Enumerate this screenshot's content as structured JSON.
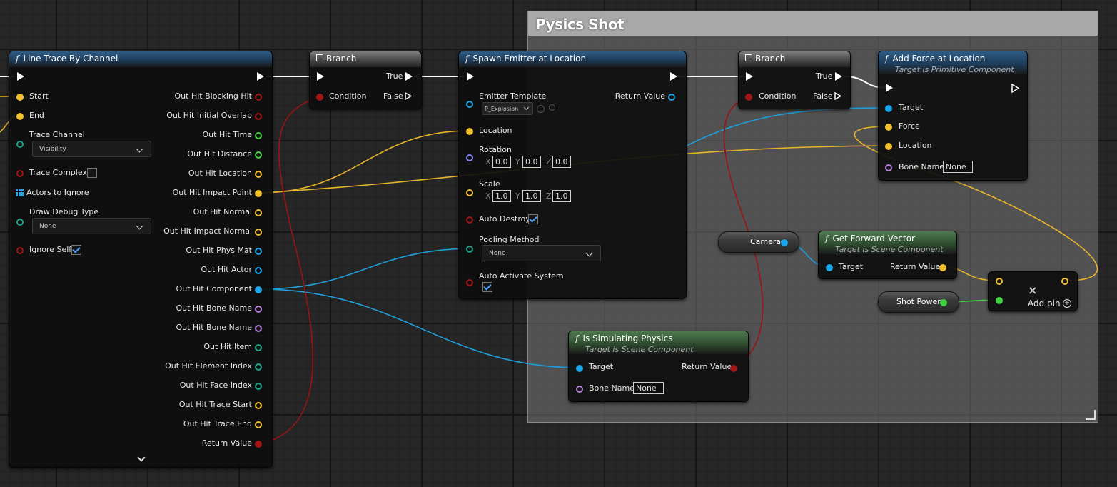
{
  "comment": {
    "title": "Pysics Shot"
  },
  "line_trace": {
    "title": "Line Trace By Channel",
    "inputs": [
      "Start",
      "End",
      "Trace Channel",
      "Trace Complex",
      "Actors to Ignore",
      "Draw Debug Type",
      "Ignore Self"
    ],
    "trace_channel_value": "Visibility",
    "draw_debug_value": "None",
    "outputs": [
      "Out Hit Blocking Hit",
      "Out Hit Initial Overlap",
      "Out Hit Time",
      "Out Hit Distance",
      "Out Hit Location",
      "Out Hit Impact Point",
      "Out Hit Normal",
      "Out Hit Impact Normal",
      "Out Hit Phys Mat",
      "Out Hit Actor",
      "Out Hit Component",
      "Out Hit Bone Name",
      "Out Hit Bone Name",
      "Out Hit Item",
      "Out Hit Element Index",
      "Out Hit Face Index",
      "Out Hit Trace Start",
      "Out Hit Trace End",
      "Return Value"
    ]
  },
  "branch1": {
    "title": "Branch",
    "condition": "Condition",
    "true": "True",
    "false": "False"
  },
  "branch2": {
    "title": "Branch",
    "condition": "Condition",
    "true": "True",
    "false": "False"
  },
  "spawn": {
    "title": "Spawn Emitter at Location",
    "emitter_template": "Emitter Template",
    "emitter_value": "P_Explosion",
    "return_value": "Return Value",
    "location": "Location",
    "rotation": "Rotation",
    "rot": {
      "x": "0.0",
      "y": "0.0",
      "z": "0.0"
    },
    "scale": "Scale",
    "scl": {
      "x": "1.0",
      "y": "1.0",
      "z": "1.0"
    },
    "axis_x": "X",
    "axis_y": "Y",
    "axis_z": "Z",
    "auto_destroy": "Auto Destroy",
    "pooling_method": "Pooling Method",
    "pooling_value": "None",
    "auto_activate": "Auto Activate System"
  },
  "add_force": {
    "title": "Add Force at Location",
    "subtitle": "Target is Primitive Component",
    "target": "Target",
    "force": "Force",
    "location": "Location",
    "bone_name": "Bone Name",
    "bone_value": "None"
  },
  "camera": {
    "label": "Camera"
  },
  "shot_power": {
    "label": "Shot Power"
  },
  "forward": {
    "title": "Get Forward Vector",
    "subtitle": "Target is Scene Component",
    "target": "Target",
    "return_value": "Return Value"
  },
  "multiply": {
    "add_pin": "Add pin"
  },
  "simulating": {
    "title": "Is Simulating Physics",
    "subtitle": "Target is Scene Component",
    "target": "Target",
    "return_value": "Return Value",
    "bone_name": "Bone Name",
    "bone_value": "None"
  },
  "colors": {
    "exec": "#ffffff",
    "vector": "#f2c12e",
    "object": "#1aa6e8",
    "bool": "#a31414",
    "float": "#3ed13e",
    "name": "#b77fdc",
    "struct": "#17a38a"
  }
}
